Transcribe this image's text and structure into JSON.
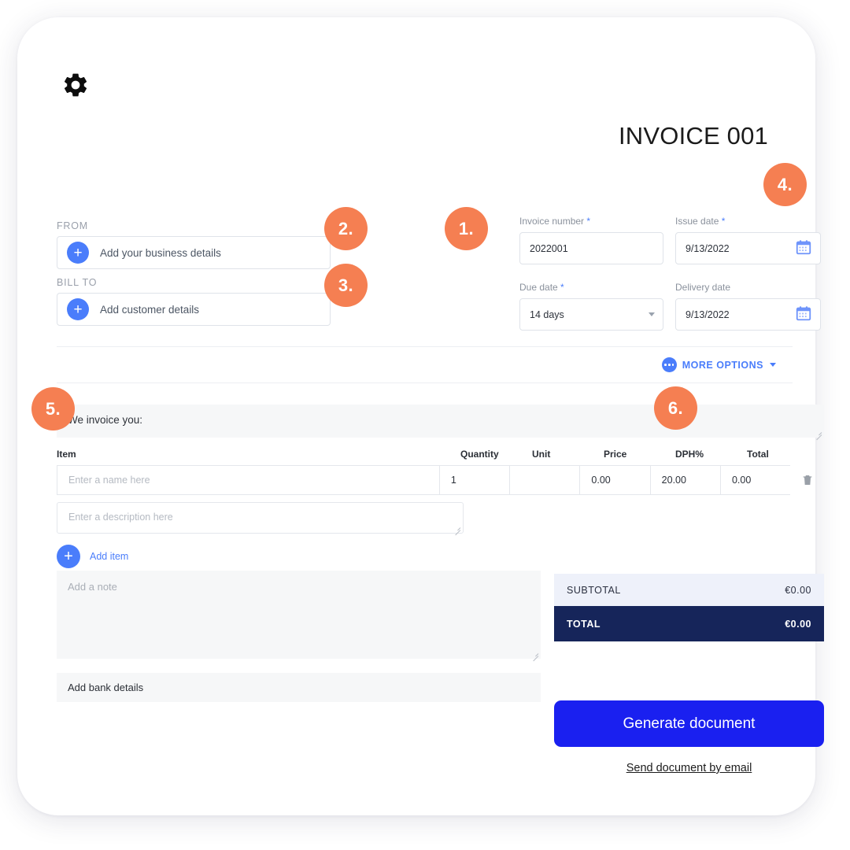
{
  "window": {
    "title": "INVOICE 001",
    "gear_icon": "gear-icon"
  },
  "parties": {
    "from_label": "FROM",
    "from_value": "Add your business details",
    "billto_label": "BILL TO",
    "billto_value": "Add customer details"
  },
  "form": {
    "invoice_number": {
      "label": "Invoice number",
      "required_mark": "*",
      "value": "2022001"
    },
    "issue_date": {
      "label": "Issue date",
      "required_mark": "*",
      "value": "9/13/2022",
      "icon": "calendar-icon"
    },
    "due_date": {
      "label": "Due date",
      "required_mark": "*",
      "value": "14 days",
      "icon": "chevron-down-icon"
    },
    "delivery_date": {
      "label": "Delivery date",
      "required_mark": "",
      "value": "9/13/2022",
      "icon": "calendar-icon"
    }
  },
  "more_options": {
    "label": "MORE OPTIONS",
    "icon": "dots-circle-icon",
    "caret": "chevron-down-icon"
  },
  "intro": {
    "text": "We invoice you:"
  },
  "items": {
    "headers": [
      "Item",
      "Quantity",
      "Unit",
      "Price",
      "DPH%",
      "Total"
    ],
    "row": {
      "item_placeholder": "Enter a name here",
      "quantity": "1",
      "unit": "",
      "price": "0.00",
      "dph": "20.00",
      "total": "0.00",
      "delete_icon": "trash-icon"
    },
    "description_placeholder": "Enter a description here",
    "add_item_label": "Add item"
  },
  "note": {
    "placeholder": "Add a note",
    "bank_label": "Add bank details"
  },
  "totals": {
    "subtotal_label": "SUBTOTAL",
    "subtotal_value": "€0.00",
    "total_label": "TOTAL",
    "total_value": "€0.00"
  },
  "actions": {
    "generate_label": "Generate document",
    "email_label": "Send document by email"
  },
  "badges": [
    {
      "id": "1",
      "label": "1."
    },
    {
      "id": "2",
      "label": "2."
    },
    {
      "id": "3",
      "label": "3."
    },
    {
      "id": "4",
      "label": "4."
    },
    {
      "id": "5",
      "label": "5."
    },
    {
      "id": "6",
      "label": "6."
    }
  ],
  "colors": {
    "badge_orange": "#f57f52",
    "accent_blue": "#4a7dfb",
    "cta_blue": "#1a20f0",
    "total_navy": "#16255a",
    "subtotal_bg": "#eef1fa"
  }
}
